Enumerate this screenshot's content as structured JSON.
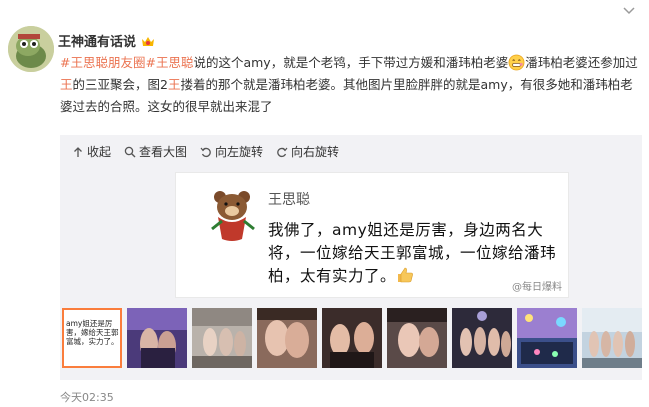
{
  "user": {
    "name": "王神通有话说"
  },
  "post": {
    "tags": [
      "#王思聪朋友圈",
      "#王思聪"
    ],
    "text_1": "说的这个amy，就是个老鸨，手下带过方媛和潘玮柏老婆",
    "text_2": "潘玮柏老婆还参加过",
    "highlight_1": "王",
    "text_3": "的三亚聚会，图2",
    "highlight_2": "王",
    "text_4": "搂着的那个就是潘玮柏老婆。其他图片里脸胖胖的就是amy，有很多她和潘玮柏老婆过去的合照。这女的很早就出来混了"
  },
  "toolbar": {
    "collapse": "收起",
    "view_large": "查看大图",
    "rotate_left": "向左旋转",
    "rotate_right": "向右旋转"
  },
  "image": {
    "name": "王思聪",
    "quote": "我佛了，amy姐还是厉害，身边两名大将，一位嫁给天王郭富城，一位嫁给潘玮柏，太有实力了。",
    "watermark": "@每日爆料"
  },
  "thumbnails": {
    "mini_text": "amy姐还是厉害，嫁给天王郭富城，实力了。"
  },
  "timestamp": "今天02:35",
  "colors": {
    "link": "#eb7350",
    "active_border": "#fa7d3c"
  }
}
